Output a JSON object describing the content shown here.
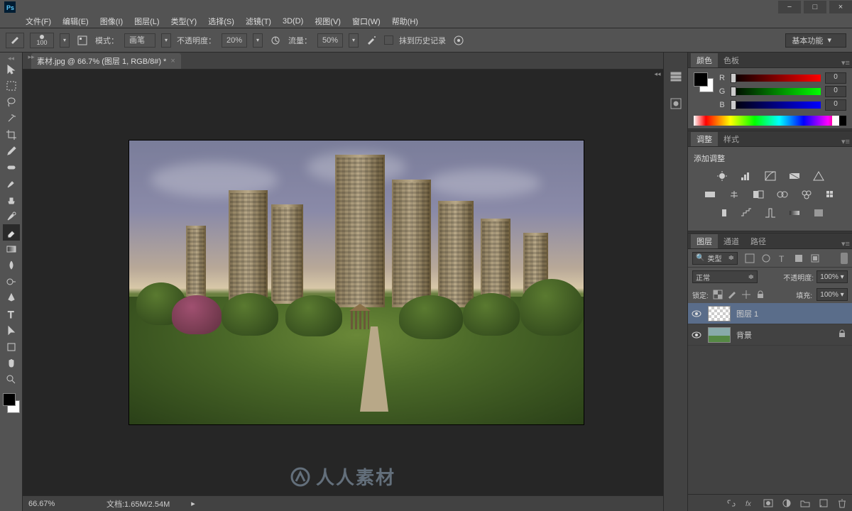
{
  "window": {
    "minimize": "−",
    "maximize": "□",
    "close": "×"
  },
  "menu": {
    "file": "文件(F)",
    "edit": "编辑(E)",
    "image": "图像(I)",
    "layer": "图层(L)",
    "type": "类型(Y)",
    "select": "选择(S)",
    "filter": "滤镜(T)",
    "three_d": "3D(D)",
    "view": "视图(V)",
    "window": "窗口(W)",
    "help": "帮助(H)"
  },
  "options": {
    "brush_size": "100",
    "mode_label": "模式：",
    "mode_value": "画笔",
    "opacity_label": "不透明度：",
    "opacity_value": "20%",
    "flow_label": "流量：",
    "flow_value": "50%",
    "erase_history": "抹到历史记录",
    "workspace": "基本功能"
  },
  "document": {
    "tab_title": "素材.jpg @ 66.7% (图层 1, RGB/8#) *"
  },
  "status": {
    "zoom": "66.67%",
    "doc_info": "文档:1.65M/2.54M"
  },
  "panels": {
    "color": {
      "tab": "颜色",
      "swatches_tab": "色板",
      "r": "R",
      "g": "G",
      "b": "B",
      "r_val": "0",
      "g_val": "0",
      "b_val": "0"
    },
    "adjust": {
      "tab": "调整",
      "styles_tab": "样式",
      "title": "添加调整"
    },
    "layers": {
      "tab": "图层",
      "channels_tab": "通道",
      "paths_tab": "路径",
      "filter_kind": "类型",
      "blend_mode": "正常",
      "opacity_label": "不透明度:",
      "opacity": "100%",
      "lock_label": "锁定:",
      "fill_label": "填充:",
      "fill": "100%",
      "layer1": "图层 1",
      "background": "背景"
    }
  },
  "watermark": "人人素材"
}
